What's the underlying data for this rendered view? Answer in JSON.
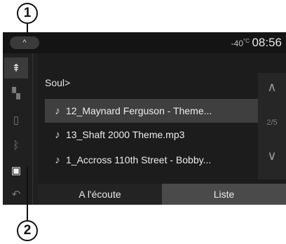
{
  "callouts": {
    "top": "1",
    "bottom": "2"
  },
  "status": {
    "collapse_icon": "^",
    "temperature": "-40",
    "temp_unit": "°C",
    "clock": "08:56"
  },
  "sidebar": {
    "items": [
      {
        "icon": "usb-icon",
        "glyph": "⇞"
      },
      {
        "icon": "media-source-icon",
        "glyph": "▚"
      },
      {
        "icon": "device-icon",
        "glyph": "▯"
      },
      {
        "icon": "bluetooth-icon",
        "glyph": "ᛒ"
      },
      {
        "icon": "playlist-icon",
        "glyph": "▣"
      },
      {
        "icon": "back-icon",
        "glyph": "↶"
      }
    ]
  },
  "list": {
    "folder": "Soul>",
    "tracks": [
      "12_Maynard Ferguson - Theme...",
      "13_Shaft 2000 Theme.mp3",
      "1_Accross 110th Street - Bobby..."
    ]
  },
  "scroll": {
    "up": "∧",
    "page": "2/5",
    "down": "∨"
  },
  "tabs": {
    "now_playing": "A l'écoute",
    "list": "Liste"
  }
}
